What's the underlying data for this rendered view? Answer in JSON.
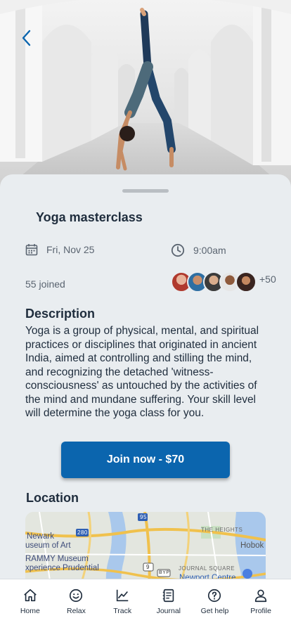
{
  "event": {
    "title": "Yoga masterclass",
    "date": "Fri, Nov 25",
    "time": "9:00am",
    "joined": "55 joined",
    "more_attendees": "+50",
    "description_heading": "Description",
    "description": "Yoga is a group of physical, mental, and spiritual practices or disciplines that originated in ancient India, aimed at controlling and stilling the mind, and recognizing the detached 'witness-consciousness' as untouched by the activities of the mind and mundane suffering. Your skill level will determine the yoga class for you.",
    "join_label": "Join now - $70",
    "location_heading": "Location"
  },
  "map": {
    "labels": {
      "newark_1": "Newark",
      "newark_2": "useum of Art",
      "grammy_1": "RAMMY Museum",
      "grammy_2": "xperience Prudential",
      "heights": "THE HEIGHTS",
      "hoboken": "Hobok",
      "journal_square": "JOURNAL SQUARE",
      "newport": "Newport Centre",
      "route_95": "95",
      "route_280": "280",
      "route_9": "9",
      "route_byp": "BYP"
    }
  },
  "nav": {
    "items": [
      {
        "label": "Home",
        "icon": "home-icon"
      },
      {
        "label": "Relax",
        "icon": "smile-icon"
      },
      {
        "label": "Track",
        "icon": "chart-icon"
      },
      {
        "label": "Journal",
        "icon": "journal-icon"
      },
      {
        "label": "Get help",
        "icon": "help-icon"
      },
      {
        "label": "Profile",
        "icon": "person-icon"
      }
    ]
  },
  "colors": {
    "primary": "#0b65ae",
    "background": "#e9edf0",
    "text": "#1f2d3d"
  }
}
